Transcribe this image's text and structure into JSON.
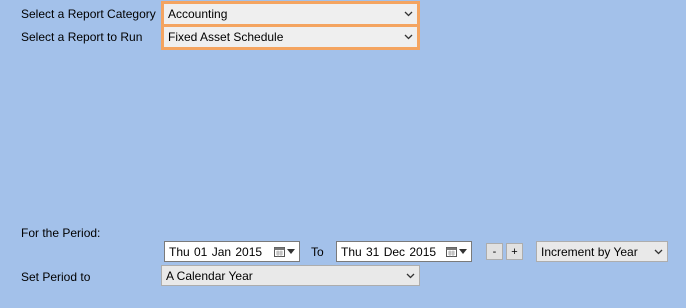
{
  "report": {
    "category_label": "Select a Report Category",
    "category_value": "Accounting",
    "report_label": "Select a Report to Run",
    "report_value": "Fixed Asset Schedule"
  },
  "period": {
    "heading": "For the Period:",
    "from_date": "Thu 01 Jan 2015",
    "to_label": "To",
    "to_date": "Thu 31 Dec 2015",
    "decrement_label": "-",
    "increment_label": "+",
    "increment_value": "Increment by Year",
    "set_label": "Set Period to",
    "set_value": "A Calendar Year"
  },
  "icons": {
    "dropdown": "chevron-down-icon",
    "calendar": "calendar-icon"
  },
  "colors": {
    "background": "#a3c1ea",
    "highlight_border": "#f4a460"
  }
}
